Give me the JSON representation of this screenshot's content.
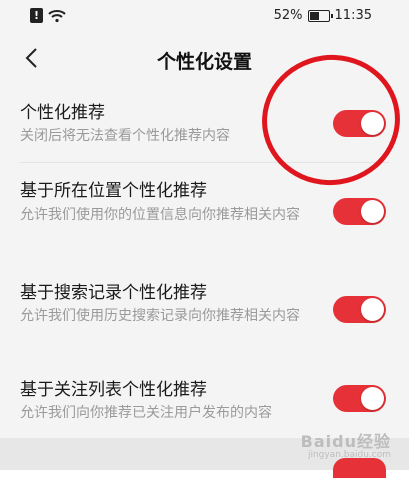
{
  "status_bar": {
    "battery": "52%",
    "time": "11:35"
  },
  "header": {
    "title": "个性化设置"
  },
  "settings": [
    {
      "title": "个性化推荐",
      "description": "关闭后将无法查看个性化推荐内容",
      "enabled": true
    },
    {
      "title": "基于所在位置个性化推荐",
      "description": "允许我们使用你的位置信息向你推荐相关内容",
      "enabled": true
    },
    {
      "title": "基于搜索记录个性化推荐",
      "description": "允许我们使用历史搜索记录向你推荐相关内容",
      "enabled": true
    },
    {
      "title": "基于关注列表个性化推荐",
      "description": "允许我们向你推荐已关注用户发布的内容",
      "enabled": true
    }
  ],
  "colors": {
    "accent": "#e53137",
    "annotation": "#e0161e",
    "background": "#f4f4f4",
    "secondary_text": "#9a9a9a"
  },
  "icons": {
    "back": "chevron-left-icon",
    "alert": "alert-icon",
    "wifi": "wifi-icon",
    "battery": "battery-icon"
  },
  "watermark": {
    "brand": "Baidu经验",
    "url": "jingyan.baidu.com"
  }
}
